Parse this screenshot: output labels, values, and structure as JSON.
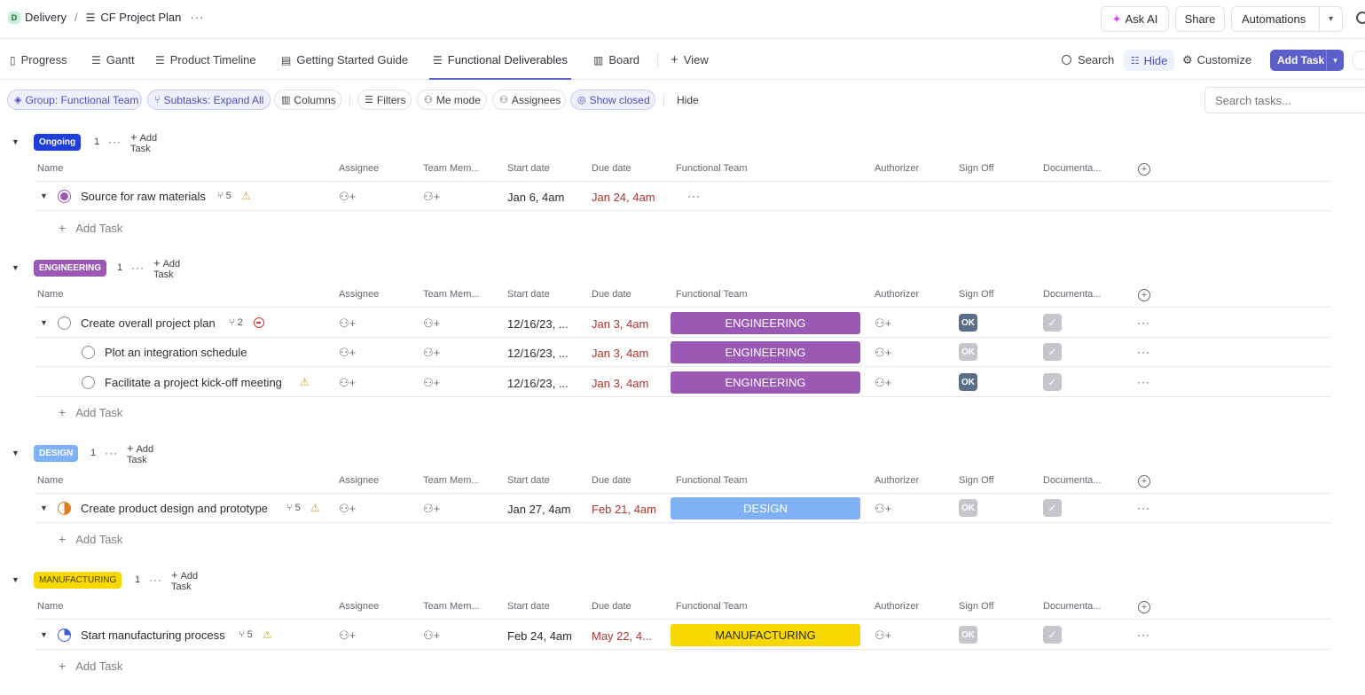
{
  "breadcrumb": {
    "workspace_initial": "D",
    "workspace": "Delivery",
    "separator": "/",
    "list": "CF Project Plan",
    "more": "···"
  },
  "topbar": {
    "ask_ai": "Ask AI",
    "share": "Share",
    "automations": "Automations"
  },
  "views": {
    "tabs": [
      {
        "label": "Progress",
        "icon": "book-icon"
      },
      {
        "label": "Gantt",
        "icon": "gantt-icon"
      },
      {
        "label": "Product Timeline",
        "icon": "timeline-icon"
      },
      {
        "label": "Getting Started Guide",
        "icon": "doc-icon"
      },
      {
        "label": "Functional Deliverables",
        "icon": "list-icon",
        "active": true
      },
      {
        "label": "Board",
        "icon": "board-icon"
      }
    ],
    "add_view": "View",
    "search": "Search",
    "hide": "Hide",
    "customize": "Customize",
    "add_task": "Add Task"
  },
  "filters": {
    "group": "Group: Functional Team",
    "subtasks": "Subtasks: Expand All",
    "columns": "Columns",
    "filters": "Filters",
    "me_mode": "Me mode",
    "assignees": "Assignees",
    "show_closed": "Show closed",
    "hide": "Hide",
    "search_placeholder": "Search tasks..."
  },
  "columns": {
    "name": "Name",
    "assignee": "Assignee",
    "team": "Team Mem...",
    "start": "Start date",
    "due": "Due date",
    "functional_team": "Functional Team",
    "authorizer": "Authorizer",
    "sign_off": "Sign Off",
    "documentation": "Documenta..."
  },
  "add_task_label": "Add Task",
  "ok_label": "OK",
  "check_glyph": "✓",
  "more_glyph": "···",
  "colors": {
    "accent": "#5b5fc7",
    "engineering": "#9b59b6",
    "design": "#7fb1f7",
    "manufacturing": "#f7d800",
    "ongoing": "#1f3fdb",
    "due_overdue": "#b0352f"
  },
  "groups": [
    {
      "label": "Ongoing",
      "count": "1",
      "tasks": [
        {
          "name": "Source for raw materials",
          "subtasks": "5",
          "warning": true,
          "start": "Jan 6, 4am",
          "due": "Jan 24, 4am",
          "team": "",
          "team_more": "···"
        }
      ]
    },
    {
      "label": "ENGINEERING",
      "count": "1",
      "tasks": [
        {
          "name": "Create overall project plan",
          "subtasks": "2",
          "blocked": true,
          "start": "12/16/23, ...",
          "due": "Jan 3, 4am",
          "team": "ENGINEERING",
          "sign_off": "active"
        },
        {
          "name": "Plot an integration schedule",
          "start": "12/16/23, ...",
          "due": "Jan 3, 4am",
          "team": "ENGINEERING",
          "sign_off": "inactive"
        },
        {
          "name": "Facilitate a project kick-off meeting",
          "warning": true,
          "start": "12/16/23, ...",
          "due": "Jan 3, 4am",
          "team": "ENGINEERING",
          "sign_off": "active"
        }
      ]
    },
    {
      "label": "DESIGN",
      "count": "1",
      "tasks": [
        {
          "name": "Create product design and prototype",
          "subtasks": "5",
          "warning": true,
          "start": "Jan 27, 4am",
          "due": "Feb 21, 4am",
          "team": "DESIGN",
          "sign_off": "inactive"
        }
      ]
    },
    {
      "label": "MANUFACTURING",
      "count": "1",
      "tasks": [
        {
          "name": "Start manufacturing process",
          "subtasks": "5",
          "warning": true,
          "start": "Feb 24, 4am",
          "due": "May 22, 4...",
          "team": "MANUFACTURING",
          "sign_off": "inactive"
        }
      ]
    }
  ]
}
